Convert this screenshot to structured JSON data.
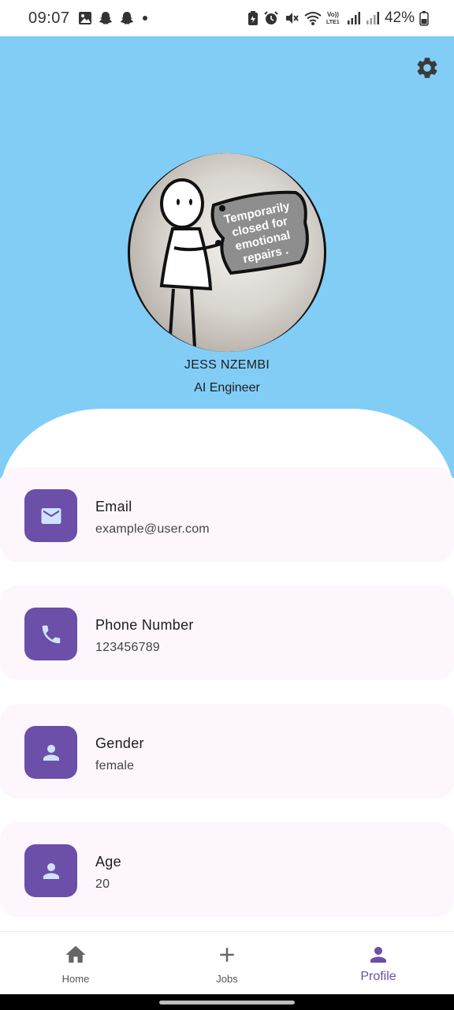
{
  "status_bar": {
    "time": "09:07",
    "battery_percent": "42%",
    "left_icons": [
      "gallery-icon",
      "snapchat-icon",
      "snapchat-icon",
      "notification-dot-icon"
    ],
    "right_icons": [
      "battery-saver-icon",
      "alarm-icon",
      "mute-icon",
      "wifi-icon",
      "volte-icon",
      "signal-icon",
      "signal-icon",
      "battery-icon"
    ],
    "volte_text": "Vo))\nLTE1"
  },
  "header": {
    "background_color": "#81cdf6",
    "settings_icon": "gear-icon",
    "avatar_sign_text": [
      "Temporarily",
      "closed for",
      "emotional",
      "repairs ."
    ],
    "name": "JESS NZEMBI",
    "title": "AI Engineer"
  },
  "cards": [
    {
      "icon": "mail-icon",
      "label": "Email",
      "value": "example@user.com"
    },
    {
      "icon": "phone-icon",
      "label": "Phone Number",
      "value": "123456789"
    },
    {
      "icon": "person-icon",
      "label": "Gender",
      "value": "female"
    },
    {
      "icon": "person-icon",
      "label": "Age",
      "value": "20"
    }
  ],
  "bottom_nav": {
    "items": [
      {
        "label": "Home",
        "icon": "home-icon",
        "active": false
      },
      {
        "label": "Jobs",
        "icon": "plus-icon",
        "active": false
      },
      {
        "label": "Profile",
        "icon": "person-icon",
        "active": true
      }
    ]
  },
  "colors": {
    "accent": "#6b4fa8",
    "icon_tint": "#cfe3ff",
    "card_background": "#fdf7fd"
  }
}
